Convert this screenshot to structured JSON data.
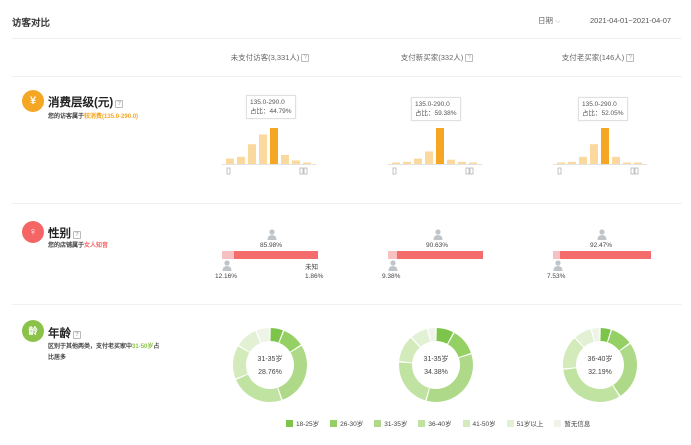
{
  "header": {
    "title": "访客对比",
    "date_granularity": "日期",
    "date_range": "2021-04-01~2021-04-07"
  },
  "columns": [
    {
      "label": "未支付访客(3,331人)"
    },
    {
      "label": "支付新买家(332人)"
    },
    {
      "label": "支付老买家(146人)"
    }
  ],
  "help_mark": "?",
  "consumption": {
    "icon": "¥",
    "title": "消费层级(元)",
    "desc_prefix": "您的访客属于",
    "desc_highlight": "较消费(135.0-290.0)",
    "columns": [
      {
        "tip_range": "135.0-290.0",
        "tip_ratio": "占比：44.79%",
        "bars": [
          0.15,
          0.2,
          0.55,
          0.82,
          1.0,
          0.25,
          0.1,
          0.04
        ],
        "highlight_index": 4
      },
      {
        "tip_range": "135.0-290.0",
        "tip_ratio": "占比：59.38%",
        "bars": [
          0.04,
          0.06,
          0.15,
          0.35,
          1.0,
          0.12,
          0.06,
          0.02
        ],
        "highlight_index": 4
      },
      {
        "tip_range": "135.0-290.0",
        "tip_ratio": "占比：52.05%",
        "bars": [
          0.04,
          0.06,
          0.2,
          0.55,
          1.0,
          0.2,
          0.04,
          0.02
        ],
        "highlight_index": 4
      }
    ]
  },
  "gender": {
    "icon": "♀",
    "title": "性别",
    "desc_prefix": "您的店铺属于",
    "desc_highlight": "女人知音",
    "unknown_label": "未知",
    "columns": [
      {
        "female_pct": "85.98%",
        "male_pct": "12.16%",
        "unknown_pct": "1.86%",
        "female_share": 0.8598,
        "male_share": 0.1216
      },
      {
        "female_pct": "90.63%",
        "male_pct": "9.38%",
        "female_share": 0.9063,
        "male_share": 0.0938
      },
      {
        "female_pct": "92.47%",
        "male_pct": "7.53%",
        "female_share": 0.9247,
        "male_share": 0.0753
      }
    ]
  },
  "age": {
    "icon": "龄",
    "title": "年龄",
    "desc_line1": "区别于其他两类，支付老买家中",
    "desc_highlight": "31-50岁",
    "desc_line2": "占比居多",
    "columns": [
      {
        "center_label": "31-35岁",
        "center_value": "28.76%",
        "shares": [
          0.06,
          0.1,
          0.2876,
          0.24,
          0.15,
          0.1,
          0.0624
        ]
      },
      {
        "center_label": "31-35岁",
        "center_value": "34.38%",
        "shares": [
          0.08,
          0.12,
          0.3438,
          0.22,
          0.12,
          0.08,
          0.0362
        ]
      },
      {
        "center_label": "36-40岁",
        "center_value": "32.19%",
        "shares": [
          0.05,
          0.1,
          0.26,
          0.3219,
          0.15,
          0.08,
          0.0381
        ]
      }
    ],
    "legend": [
      "18-25岁",
      "26-30岁",
      "31-35岁",
      "36-40岁",
      "41-50岁",
      "51岁以上",
      "暂无信息"
    ],
    "legend_colors": [
      "#7cc44a",
      "#94d064",
      "#aed988",
      "#c1e3a2",
      "#d3eabb",
      "#e2f0d3",
      "#eef4e8"
    ]
  },
  "colors": {
    "bar": "#fbd89e",
    "bar_highlight": "#f5a623",
    "female": "#f56c6c",
    "male": "#f7c1c1",
    "orange": "#f5a623",
    "red": "#f56565",
    "green": "#8bc34a"
  }
}
